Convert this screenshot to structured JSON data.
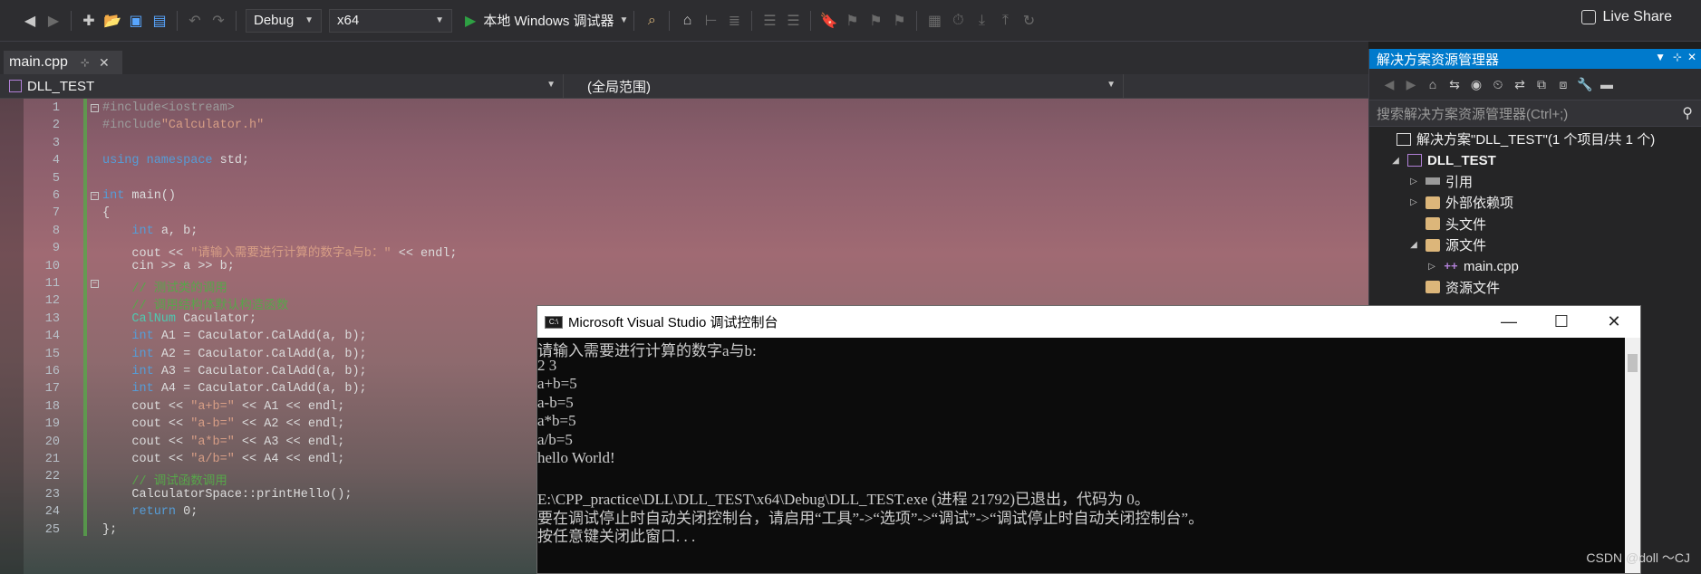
{
  "toolbar": {
    "config": "Debug",
    "platform": "x64",
    "run_label": "本地 Windows 调试器",
    "live_share": "Live Share"
  },
  "editor": {
    "tab_title": "main.cpp",
    "nav_project": "DLL_TEST",
    "nav_scope": "(全局范围)",
    "lines": [
      {
        "n": "1",
        "parts": [
          {
            "t": "#include",
            "c": "pp"
          },
          {
            "t": "<iostream>",
            "c": "pp"
          }
        ],
        "fold": "−"
      },
      {
        "n": "2",
        "parts": [
          {
            "t": "#include",
            "c": "pp"
          },
          {
            "t": "\"Calculator.h\"",
            "c": "str"
          }
        ]
      },
      {
        "n": "3",
        "parts": []
      },
      {
        "n": "4",
        "parts": [
          {
            "t": "using namespace ",
            "c": "kw"
          },
          {
            "t": "std;",
            "c": ""
          }
        ]
      },
      {
        "n": "5",
        "parts": []
      },
      {
        "n": "6",
        "parts": [
          {
            "t": "int ",
            "c": "kw"
          },
          {
            "t": "main()",
            "c": ""
          }
        ],
        "fold": "−"
      },
      {
        "n": "7",
        "parts": [
          {
            "t": "{",
            "c": ""
          }
        ]
      },
      {
        "n": "8",
        "parts": [
          {
            "t": "    int ",
            "c": "kw"
          },
          {
            "t": "a, b;",
            "c": ""
          }
        ]
      },
      {
        "n": "9",
        "parts": [
          {
            "t": "    cout << ",
            "c": ""
          },
          {
            "t": "\"请输入需要进行计算的数字a与b：\"",
            "c": "str"
          },
          {
            "t": " << endl;",
            "c": ""
          }
        ]
      },
      {
        "n": "10",
        "parts": [
          {
            "t": "    cin >> a >> b;",
            "c": ""
          }
        ]
      },
      {
        "n": "11",
        "parts": [
          {
            "t": "    // 测试类的调用",
            "c": "cm"
          }
        ],
        "fold": "−"
      },
      {
        "n": "12",
        "parts": [
          {
            "t": "    // 调用结构体默认构造函数",
            "c": "cm"
          }
        ]
      },
      {
        "n": "13",
        "parts": [
          {
            "t": "    CalNum ",
            "c": "ty"
          },
          {
            "t": "Caculator;",
            "c": ""
          }
        ]
      },
      {
        "n": "14",
        "parts": [
          {
            "t": "    int ",
            "c": "kw"
          },
          {
            "t": "A1 = Caculator.CalAdd(a, b);",
            "c": ""
          }
        ]
      },
      {
        "n": "15",
        "parts": [
          {
            "t": "    int ",
            "c": "kw"
          },
          {
            "t": "A2 = Caculator.CalAdd(a, b);",
            "c": ""
          }
        ]
      },
      {
        "n": "16",
        "parts": [
          {
            "t": "    int ",
            "c": "kw"
          },
          {
            "t": "A3 = Caculator.CalAdd(a, b);",
            "c": ""
          }
        ]
      },
      {
        "n": "17",
        "parts": [
          {
            "t": "    int ",
            "c": "kw"
          },
          {
            "t": "A4 = Caculator.CalAdd(a, b);",
            "c": ""
          }
        ]
      },
      {
        "n": "18",
        "parts": [
          {
            "t": "    cout << ",
            "c": ""
          },
          {
            "t": "\"a+b=\"",
            "c": "str"
          },
          {
            "t": " << A1 << endl;",
            "c": ""
          }
        ]
      },
      {
        "n": "19",
        "parts": [
          {
            "t": "    cout << ",
            "c": ""
          },
          {
            "t": "\"a-b=\"",
            "c": "str"
          },
          {
            "t": " << A2 << endl;",
            "c": ""
          }
        ]
      },
      {
        "n": "20",
        "parts": [
          {
            "t": "    cout << ",
            "c": ""
          },
          {
            "t": "\"a*b=\"",
            "c": "str"
          },
          {
            "t": " << A3 << endl;",
            "c": ""
          }
        ]
      },
      {
        "n": "21",
        "parts": [
          {
            "t": "    cout << ",
            "c": ""
          },
          {
            "t": "\"a/b=\"",
            "c": "str"
          },
          {
            "t": " << A4 << endl;",
            "c": ""
          }
        ]
      },
      {
        "n": "22",
        "parts": [
          {
            "t": "    // 调试函数调用",
            "c": "cm"
          }
        ]
      },
      {
        "n": "23",
        "parts": [
          {
            "t": "    CalculatorSpace::printHello();",
            "c": ""
          }
        ]
      },
      {
        "n": "24",
        "parts": [
          {
            "t": "    return ",
            "c": "kw"
          },
          {
            "t": "0;",
            "c": ""
          }
        ]
      },
      {
        "n": "25",
        "parts": [
          {
            "t": "};",
            "c": ""
          }
        ]
      }
    ]
  },
  "solution_explorer": {
    "title": "解决方案资源管理器",
    "search_placeholder": "搜索解决方案资源管理器(Ctrl+;)",
    "items": [
      {
        "label": "解决方案\"DLL_TEST\"(1 个项目/共 1 个)",
        "icon": "solution-icon",
        "indent": 0,
        "twisty": ""
      },
      {
        "label": "DLL_TEST",
        "icon": "project-icon",
        "indent": 1,
        "twisty": "◢",
        "bold": true
      },
      {
        "label": "引用",
        "icon": "references-icon",
        "indent": 2,
        "twisty": "▷"
      },
      {
        "label": "外部依赖项",
        "icon": "folder-icon",
        "indent": 2,
        "twisty": "▷"
      },
      {
        "label": "头文件",
        "icon": "folder-icon",
        "indent": 2,
        "twisty": ""
      },
      {
        "label": "源文件",
        "icon": "folder-icon",
        "indent": 2,
        "twisty": "◢"
      },
      {
        "label": "main.cpp",
        "icon": "cpp-file-icon",
        "indent": 3,
        "twisty": "▷"
      },
      {
        "label": "资源文件",
        "icon": "folder-icon",
        "indent": 2,
        "twisty": ""
      }
    ]
  },
  "console": {
    "title": "Microsoft Visual Studio 调试控制台",
    "lines": [
      "请输入需要进行计算的数字a与b:",
      "2 3",
      "a+b=5",
      "a-b=5",
      "a*b=5",
      "a/b=5",
      "hello World!",
      "",
      "E:\\CPP_practice\\DLL\\DLL_TEST\\x64\\Debug\\DLL_TEST.exe (进程 21792)已退出，代码为 0。",
      "要在调试停止时自动关闭控制台，请启用“工具”->“选项”->“调试”->“调试停止时自动关闭控制台”。",
      "按任意键关闭此窗口. . ."
    ]
  },
  "watermark": "CSDN @doll ～CJ"
}
